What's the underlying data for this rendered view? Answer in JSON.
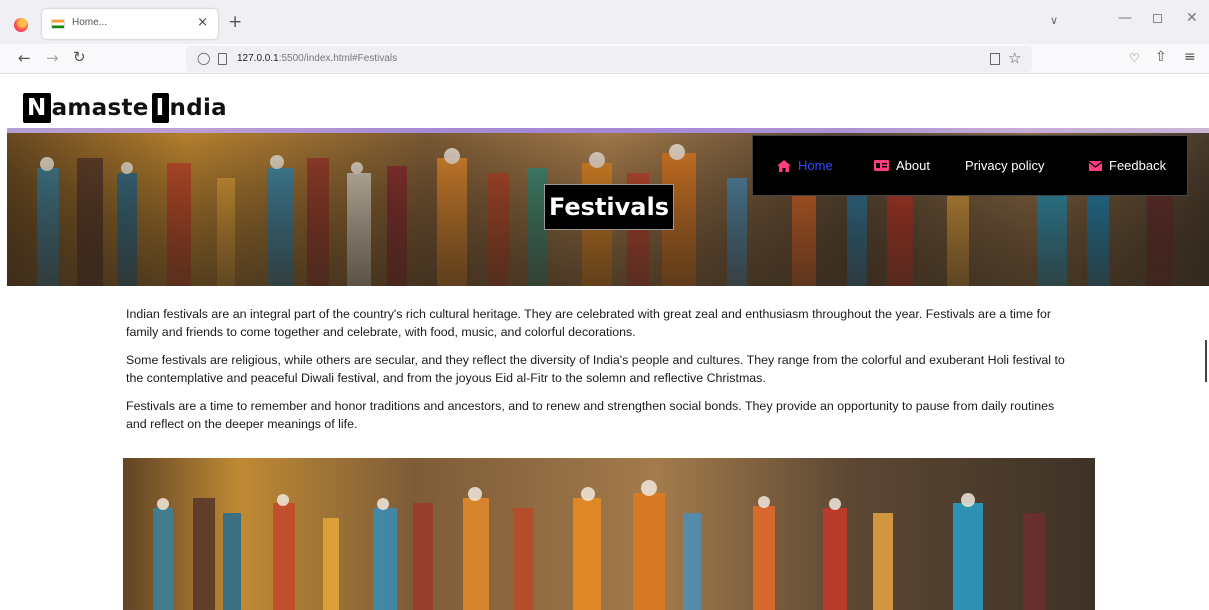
{
  "browser": {
    "tab_title": "Home...",
    "tab_close": "×",
    "new_tab": "+",
    "url_host": "127.0.0.1",
    "url_rest": ":5500/index.html#Festivals"
  },
  "site": {
    "brand_letter_1": "N",
    "brand_word_1": "amaste",
    "brand_letter_2": "I",
    "brand_word_2": "ndia"
  },
  "hero": {
    "title": "Festivals"
  },
  "nav": {
    "items": [
      {
        "label": "Home",
        "icon": "home-icon",
        "active": true
      },
      {
        "label": "About",
        "icon": "id-card-icon"
      },
      {
        "label": "Privacy policy",
        "icon": ""
      },
      {
        "label": "Feedback",
        "icon": "envelope-icon"
      }
    ],
    "active_color": "#2f4cff"
  },
  "content": {
    "paragraphs": [
      "Indian festivals are an integral part of the country's rich cultural heritage. They are celebrated with great zeal and enthusiasm throughout the year. Festivals are a time for family and friends to come together and celebrate, with food, music, and colorful decorations.",
      "Some festivals are religious, while others are secular, and they reflect the diversity of India's people and cultures. They range from the colorful and exuberant Holi festival to the contemplative and peaceful Diwali festival, and from the joyous Eid al-Fitr to the solemn and reflective Christmas.",
      "Festivals are a time to remember and honor traditions and ancestors, and to renew and strengthen social bonds. They provide an opportunity to pause from daily routines and reflect on the deeper meanings of life."
    ]
  }
}
